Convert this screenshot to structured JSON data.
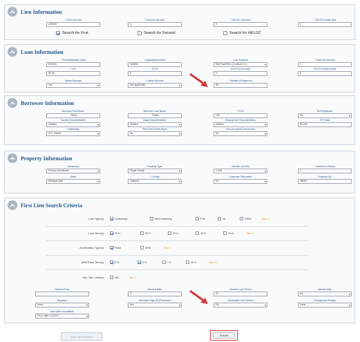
{
  "colors": {
    "title": "#27548a",
    "required": "#d02020",
    "arrow": "#d23a3a",
    "max": "#e8a400",
    "checkmark": "#2a5dae"
  },
  "lien": {
    "title": "Lien Information",
    "fields": [
      {
        "label": "First Lien Amt",
        "value": "400000"
      },
      {
        "label": "Second Lien Amt",
        "value": "0"
      },
      {
        "label": "HELOC Lien Amt",
        "value": "0"
      },
      {
        "label": "HELOC Drawn Amt",
        "value": "0"
      }
    ],
    "checks": [
      {
        "label": "Search for First",
        "checked": true
      },
      {
        "label": "Search for Second",
        "checked": false
      },
      {
        "label": "Search for HELOC",
        "checked": false
      }
    ]
  },
  "loan": {
    "title": "Loan Information",
    "fields": [
      {
        "label": "Price/Estimated Value",
        "value": "500000"
      },
      {
        "label": "Appraised Amount",
        "value": "500000"
      },
      {
        "label": "Loan Purpose",
        "value": "Refi Rate/Term (Limited C.O.)"
      },
      {
        "label": "Cash-Out Amount",
        "value": "0"
      },
      {
        "label": "LTV",
        "value": "80.00"
      },
      {
        "label": "CLTV",
        "value": "0"
      },
      {
        "label": "HCLTV (Line Amt)",
        "value": "0"
      },
      {
        "label": "HCLTV (Drawn Amt)",
        "value": "0"
      },
      {
        "label": "Waive Escrows",
        "value": "Yes"
      },
      {
        "label": "Current Servicer",
        "value": "Not Applicable"
      },
      {
        "label": "Months of Reserves",
        "value": "36"
      }
    ]
  },
  "borrower": {
    "title": "Borrower Information",
    "fields": [
      {
        "label": "Borrower First Name",
        "value": "Harry"
      },
      {
        "label": "Borrower Last Name",
        "value": "Potter"
      },
      {
        "label": "FICO",
        "value": "720"
      },
      {
        "label": "Self Employed",
        "value": "No"
      },
      {
        "label": "Income Documentation",
        "value": "Verified"
      },
      {
        "label": "Asset Documentation",
        "value": "Verified"
      },
      {
        "label": "Employment Documentation",
        "value": "Verified"
      },
      {
        "label": "DTI Ratio",
        "value": "30.000"
      },
      {
        "label": "Citizenship",
        "value": "U.S. Citizen"
      },
      {
        "label": "First Time Home Buyer",
        "value": "No"
      },
      {
        "label": "Non-Occupant Coborrower",
        "value": "No"
      }
    ]
  },
  "property": {
    "title": "Property Information",
    "fields": [
      {
        "label": "Occupancy",
        "value": "Primary Residence"
      },
      {
        "label": "Property Type",
        "value": "Single Family"
      },
      {
        "label": "Number of Units",
        "value": "1 Unit"
      },
      {
        "label": "Number of Stories",
        "value": "1"
      },
      {
        "label": "State",
        "value": "Michigan (MI)"
      },
      {
        "label": "County",
        "value": "Oakland"
      },
      {
        "label": "Corporate Relocation",
        "value": "No"
      },
      {
        "label": "Property Zip",
        "value": "48069"
      }
    ]
  },
  "criteria": {
    "title": "First Lien Search Criteria",
    "rows": [
      {
        "label": "Loan Type(s):",
        "max": "Max: 4",
        "options": [
          {
            "label": "Conforming",
            "checked": true
          },
          {
            "label": "NonConforming",
            "checked": false
          },
          {
            "label": "FHA",
            "checked": false
          },
          {
            "label": "VA",
            "checked": false
          },
          {
            "label": "USDA",
            "checked": false
          }
        ]
      },
      {
        "label": "Loan Term(s):",
        "max": "Max: 4",
        "options": [
          {
            "label": "30 Yr",
            "checked": true
          },
          {
            "label": "25 Yr",
            "checked": false
          },
          {
            "label": "20 Yr",
            "checked": false
          },
          {
            "label": "15 Yr",
            "checked": false
          },
          {
            "label": "10 Yr",
            "checked": false
          }
        ]
      },
      {
        "label": "Amortization Type(s):",
        "max": "Max: 2",
        "options": [
          {
            "label": "Fixed",
            "checked": true
          },
          {
            "label": "ARM",
            "checked": false
          }
        ]
      },
      {
        "label": "ARM Fixed Term(s):",
        "max": "Max: 4",
        "options": [
          {
            "label": "3 Yr",
            "checked": true
          },
          {
            "label": "5 Yr",
            "checked": true
          },
          {
            "label": "7 Yr",
            "checked": false
          },
          {
            "label": "10 Yr",
            "checked": false
          }
        ]
      },
      {
        "label": "Exp. Opt. Level(s):",
        "max": "Max: 2",
        "options": [
          {
            "label": "N/A",
            "checked": false
          }
        ]
      }
    ],
    "fields": [
      {
        "label": "Desired Price",
        "value": ""
      },
      {
        "label": "Desired Rate",
        "value": "0"
      },
      {
        "label": "Desired Lock Period",
        "value": "30"
      },
      {
        "label": "Interest Only",
        "value": "No"
      },
      {
        "label": "Buydown",
        "value": "None"
      },
      {
        "label": "Borrower Pays MI (Financed)",
        "value": "Yes"
      },
      {
        "label": "Automated U/W System",
        "value": "DU"
      },
      {
        "label": "Prepayment Penalty",
        "value": "None"
      },
      {
        "label": "Max Date of Available",
        "value": "On or after 1/1/2017"
      }
    ]
  },
  "buttons": {
    "save": "Save As Prospect",
    "submit": "Submit"
  }
}
